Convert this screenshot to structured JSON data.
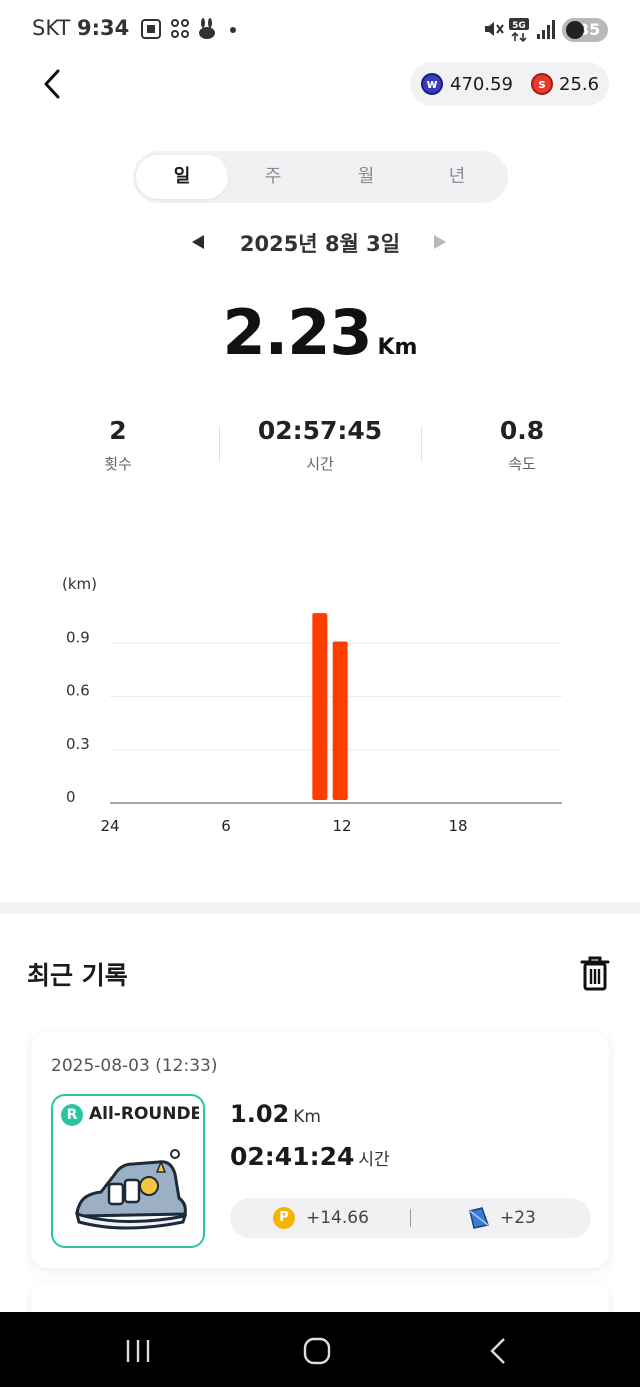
{
  "status_bar": {
    "carrier": "SKT",
    "time": "9:34",
    "network": "5G",
    "battery": "35"
  },
  "wallet": {
    "primary_icon": "w-token-icon",
    "primary_value": "470.59",
    "secondary_icon": "s-token-icon",
    "secondary_value": "25.6"
  },
  "tabs": [
    {
      "label": "일",
      "active": true
    },
    {
      "label": "주",
      "active": false
    },
    {
      "label": "월",
      "active": false
    },
    {
      "label": "년",
      "active": false
    }
  ],
  "date_nav": {
    "label": "2025년 8월 3일"
  },
  "summary": {
    "distance": "2.23",
    "distance_unit": "Km",
    "stats": [
      {
        "value": "2",
        "label": "횟수"
      },
      {
        "value": "02:57:45",
        "label": "시간"
      },
      {
        "value": "0.8",
        "label": "속도"
      }
    ]
  },
  "chart_data": {
    "type": "bar",
    "ylabel": "(km)",
    "y_ticks": [
      "0",
      "0.3",
      "0.6",
      "0.9"
    ],
    "ylim": [
      0,
      1.2
    ],
    "x_ticks": [
      "24",
      "6",
      "12",
      "18"
    ],
    "xlim": [
      0,
      24
    ],
    "bar_color": "#ff3d00",
    "x": [
      11,
      12
    ],
    "values": [
      1.07,
      0.91
    ],
    "grid": true
  },
  "recent": {
    "title": "최근 기록",
    "records": [
      {
        "datetime": "2025-08-03 (12:33)",
        "badge": "R",
        "shoe_type": "All-ROUNDER",
        "distance": "1.02",
        "distance_unit": "Km",
        "duration": "02:41:24",
        "duration_unit": "시간",
        "point_icon": "p-coin-icon",
        "point_reward": "+14.66",
        "tile_icon": "tile-icon",
        "tile_reward": "+23"
      }
    ]
  },
  "colors": {
    "accent": "#ff3d00",
    "badge": "#2bc3a3",
    "point": "#f5b400"
  }
}
